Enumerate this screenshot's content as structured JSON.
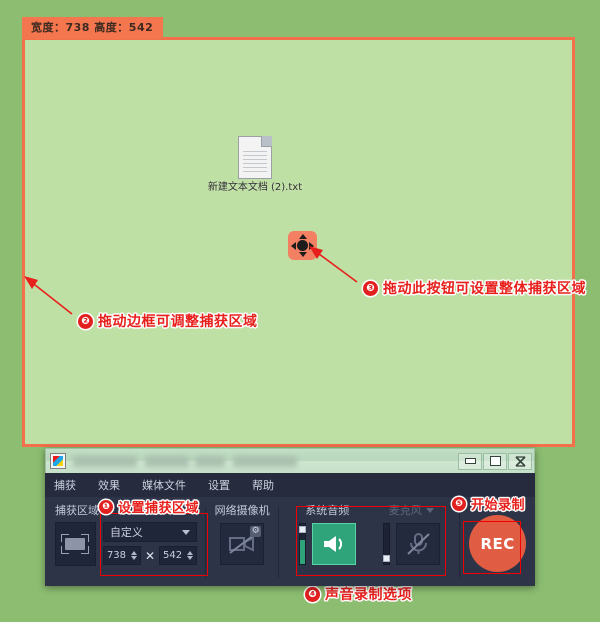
{
  "desktop": {
    "background_color": "#8cbd71",
    "capture_fill_color": "#bfe0a4",
    "capture_border_color": "#f4704a",
    "file_icon": {
      "name": "新建文本文档 (2).txt"
    }
  },
  "size_badge": {
    "text": "宽度：738  高度：542",
    "background": "#f4764f"
  },
  "annotations": [
    {
      "num": "❶",
      "text": "设置捕获区域"
    },
    {
      "num": "❷",
      "text": "拖动边框可调整捕获区域"
    },
    {
      "num": "❸",
      "text": "拖动此按钮可设置整体捕获区域"
    },
    {
      "num": "❹",
      "text": "声音录制选项"
    },
    {
      "num": "❺",
      "text": "开始录制"
    }
  ],
  "annotation_color": "#e8201c",
  "window": {
    "title": "",
    "title_redacted": true,
    "controls": {
      "minimize": "最小化",
      "maximize": "最大化",
      "close": "关闭"
    },
    "menu": [
      {
        "label": "捕获"
      },
      {
        "label": "效果"
      },
      {
        "label": "媒体文件"
      },
      {
        "label": "设置"
      },
      {
        "label": "帮助"
      }
    ],
    "capture_area": {
      "title": "捕获区域",
      "preset_value": "自定义",
      "width_value": "738",
      "separator": "✕",
      "height_value": "542"
    },
    "webcam": {
      "title": "网络摄像机",
      "enabled": false,
      "gear": "⚙"
    },
    "audio": {
      "system": {
        "title": "系统音频",
        "enabled": true,
        "level": 62
      },
      "microphone": {
        "title": "麦克风",
        "enabled": false,
        "level": 8
      }
    },
    "record": {
      "label": "REC",
      "color": "#e05c42"
    }
  }
}
